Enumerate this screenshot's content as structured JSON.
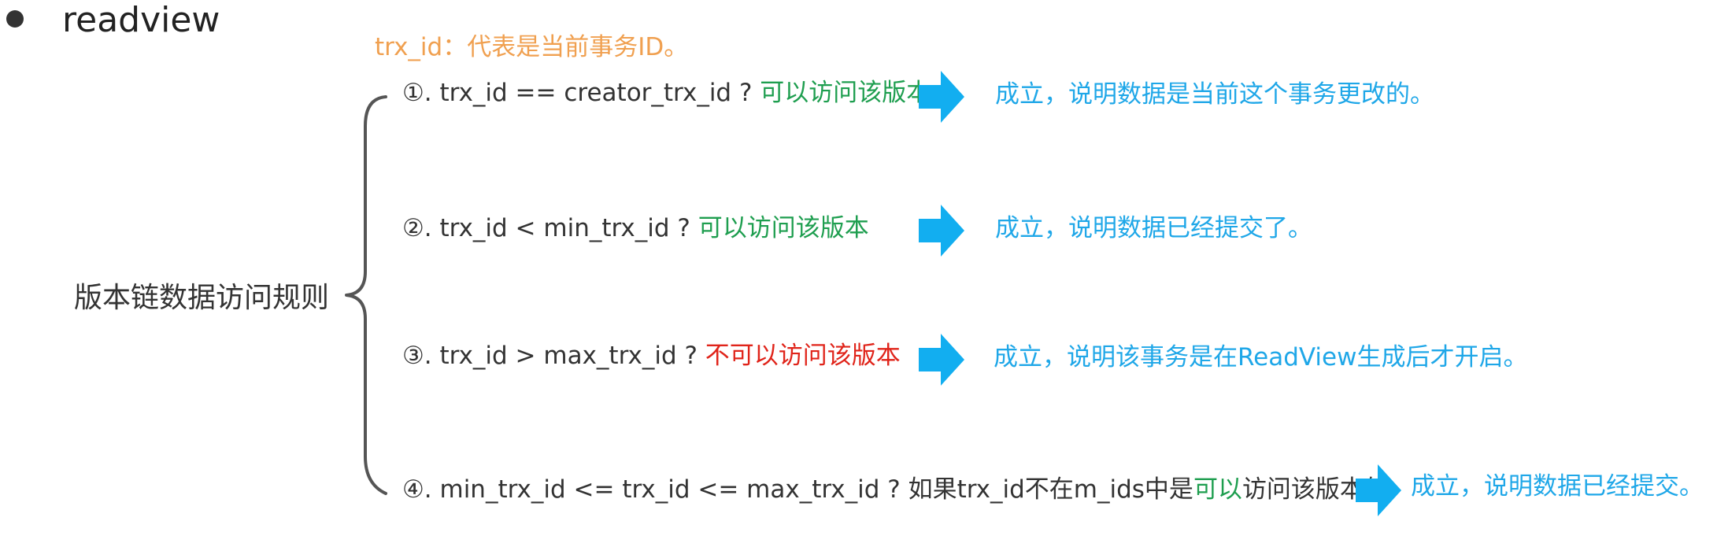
{
  "heading": "readview",
  "legend": "trx_id：代表是当前事务ID。",
  "left_label": "版本链数据访问规则",
  "colors": {
    "legend": "#F0A050",
    "allow": "#1E9E4F",
    "deny": "#E0241A",
    "result": "#1FA7E8",
    "arrow": "#12AEF0",
    "text": "#333333"
  },
  "rules": [
    {
      "condition": "①. trx_id  == creator_trx_id ? ",
      "verdict": "可以访问该版本",
      "result": "成立，说明数据是当前这个事务更改的。"
    },
    {
      "condition": "②. trx_id < min_trx_id ? ",
      "verdict": "可以访问该版本",
      "result": "成立，说明数据已经提交了。"
    },
    {
      "condition": "③. trx_id > max_trx_id ?  ",
      "verdict": "不可以访问该版本",
      "result": "成立，说明该事务是在ReadView生成后才开启。"
    },
    {
      "condition": "④. min_trx_id <= trx_id <= max_trx_id ?  如果trx_id不在m_ids中是",
      "verdict": "可以",
      "tail": "访问该版本的",
      "result": "成立，说明数据已经提交。"
    }
  ]
}
